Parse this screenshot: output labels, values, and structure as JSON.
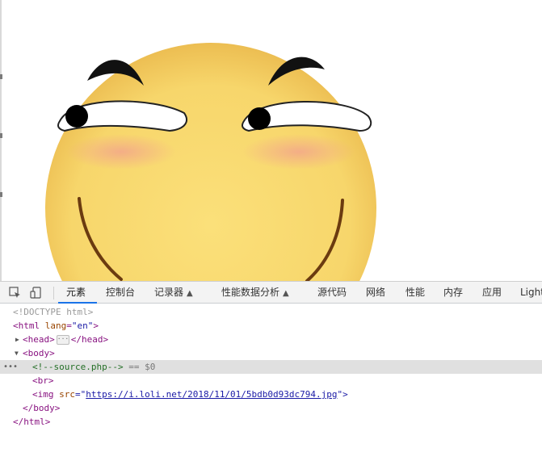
{
  "devtools": {
    "tabs": [
      {
        "label": "元素",
        "active": true
      },
      {
        "label": "控制台"
      },
      {
        "label": "记录器"
      },
      {
        "label": "性能数据分析"
      },
      {
        "label": "源代码"
      },
      {
        "label": "网络"
      },
      {
        "label": "性能"
      },
      {
        "label": "内存"
      },
      {
        "label": "应用"
      },
      {
        "label": "Light"
      }
    ],
    "accent_color": "#1a73e8",
    "icons": [
      "inspect-cursor-icon",
      "device-toggle-icon",
      "flask-icon"
    ]
  },
  "dom": {
    "doctype": "<!DOCTYPE html>",
    "html_open": "<html",
    "html_attr": "lang",
    "html_attr_val": "\"en\"",
    "html_gt": ">",
    "head_open": "<head>",
    "head_close": "</head>",
    "body_open": "<body>",
    "comment": "<!--source.php-->",
    "eq_ref": "== $0",
    "br": "<br>",
    "img_open": "<img",
    "img_attr": "src",
    "img_eq": "=\"",
    "img_src": "https://i.loli.net/2018/11/01/5bdb0d93dc794.jpg",
    "img_end": "\">",
    "body_close": "</body>",
    "html_close": "</html>"
  }
}
